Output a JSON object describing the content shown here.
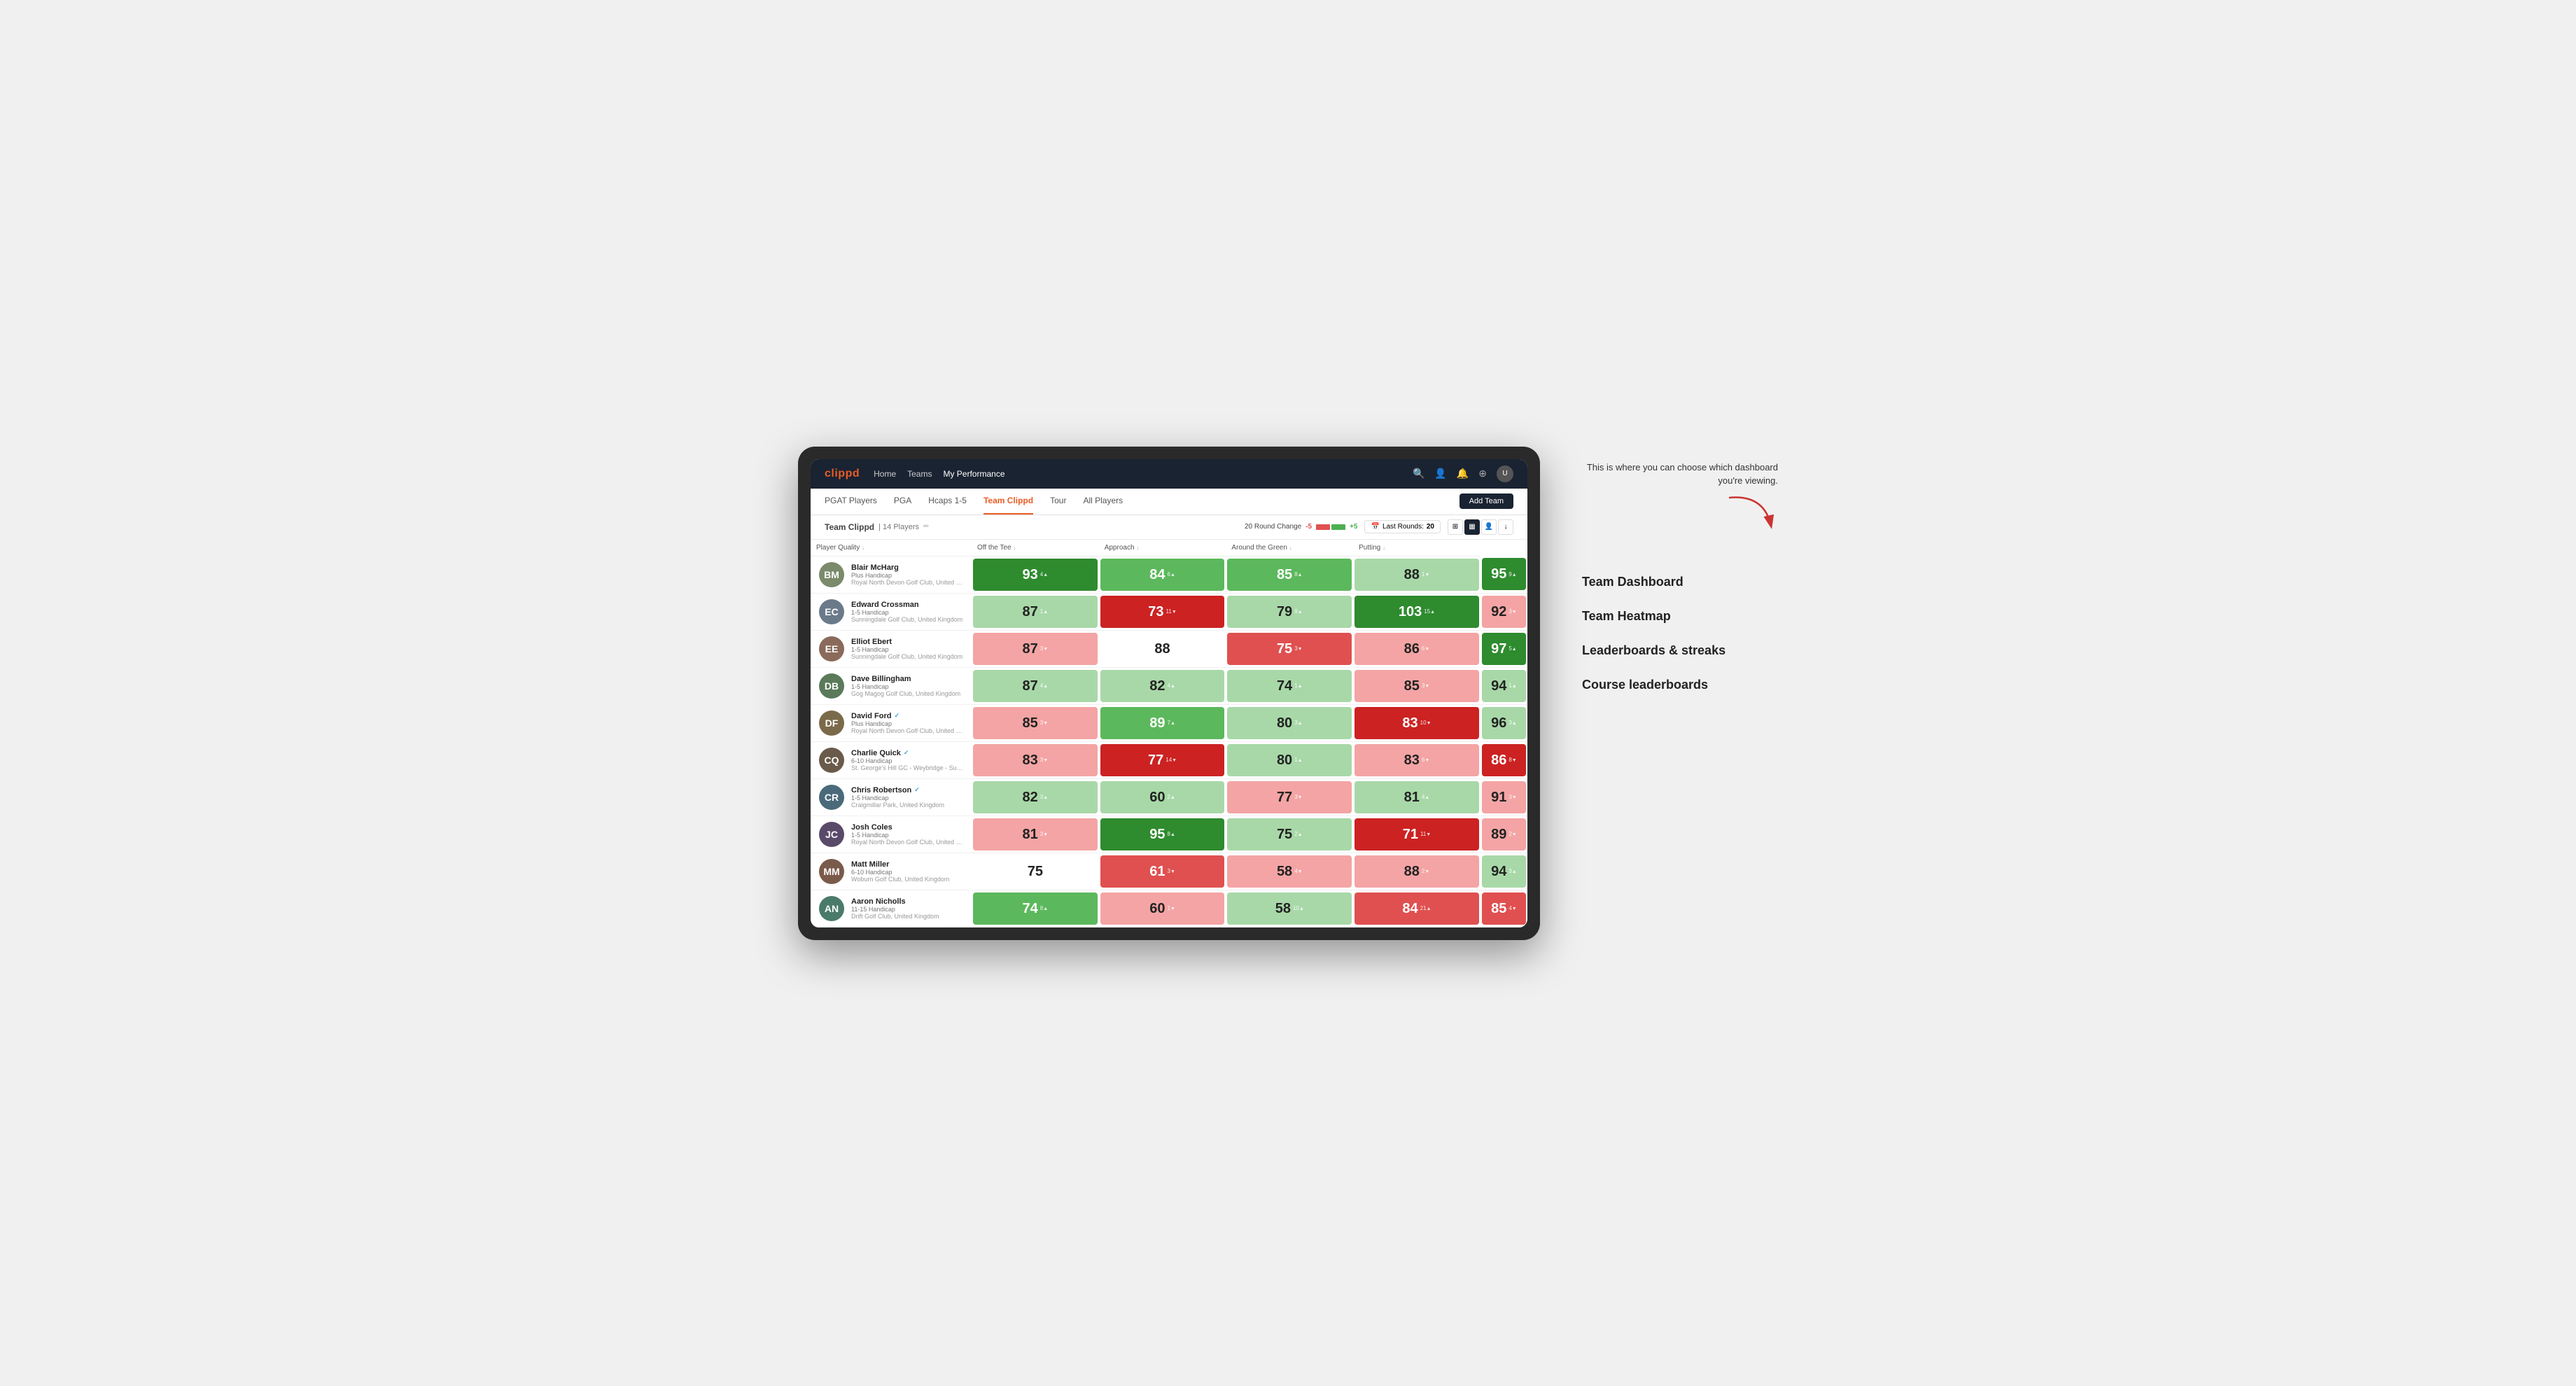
{
  "nav": {
    "logo": "clippd",
    "links": [
      "Home",
      "Teams",
      "My Performance"
    ],
    "active_link": "My Performance",
    "icons": [
      "🔍",
      "👤",
      "🔔",
      "⊕",
      "👤"
    ]
  },
  "sub_nav": {
    "links": [
      "PGAT Players",
      "PGA",
      "Hcaps 1-5",
      "Team Clippd",
      "Tour",
      "All Players"
    ],
    "active_link": "Team Clippd",
    "add_team_label": "Add Team"
  },
  "team_header": {
    "team_name": "Team Clippd",
    "separator": "|",
    "player_count": "14 Players",
    "round_change_label": "20 Round Change",
    "neg_label": "-5",
    "pos_label": "+5",
    "last_rounds_label": "Last Rounds:",
    "last_rounds_value": "20"
  },
  "table": {
    "columns": [
      {
        "key": "player",
        "label": "Player Quality",
        "arrow": "↓"
      },
      {
        "key": "off_tee",
        "label": "Off the Tee",
        "arrow": "↓"
      },
      {
        "key": "approach",
        "label": "Approach",
        "arrow": "↓"
      },
      {
        "key": "around_green",
        "label": "Around the Green",
        "arrow": "↓"
      },
      {
        "key": "putting",
        "label": "Putting",
        "arrow": "↓"
      }
    ],
    "rows": [
      {
        "name": "Blair McHarg",
        "handicap": "Plus Handicap",
        "club": "Royal North Devon Golf Club, United Kingdom",
        "initials": "BM",
        "avatar_color": "#7a8a6a",
        "scores": [
          {
            "value": "93",
            "delta": "4",
            "dir": "up",
            "bg": "bg-green-strong"
          },
          {
            "value": "84",
            "delta": "6",
            "dir": "up",
            "bg": "bg-green-mid"
          },
          {
            "value": "85",
            "delta": "8",
            "dir": "up",
            "bg": "bg-green-mid"
          },
          {
            "value": "88",
            "delta": "1",
            "dir": "down",
            "bg": "bg-green-light"
          },
          {
            "value": "95",
            "delta": "9",
            "dir": "up",
            "bg": "bg-green-strong"
          }
        ]
      },
      {
        "name": "Edward Crossman",
        "handicap": "1-5 Handicap",
        "club": "Sunningdale Golf Club, United Kingdom",
        "initials": "EC",
        "avatar_color": "#6a7a8a",
        "scores": [
          {
            "value": "87",
            "delta": "1",
            "dir": "up",
            "bg": "bg-green-light"
          },
          {
            "value": "73",
            "delta": "11",
            "dir": "down",
            "bg": "bg-red-strong"
          },
          {
            "value": "79",
            "delta": "9",
            "dir": "up",
            "bg": "bg-green-light"
          },
          {
            "value": "103",
            "delta": "15",
            "dir": "up",
            "bg": "bg-green-strong"
          },
          {
            "value": "92",
            "delta": "3",
            "dir": "down",
            "bg": "bg-red-light"
          }
        ]
      },
      {
        "name": "Elliot Ebert",
        "handicap": "1-5 Handicap",
        "club": "Sunningdale Golf Club, United Kingdom",
        "initials": "EE",
        "avatar_color": "#8a6a5a",
        "scores": [
          {
            "value": "87",
            "delta": "3",
            "dir": "down",
            "bg": "bg-red-light"
          },
          {
            "value": "88",
            "delta": "",
            "dir": "",
            "bg": "bg-white"
          },
          {
            "value": "75",
            "delta": "3",
            "dir": "down",
            "bg": "bg-red-mid"
          },
          {
            "value": "86",
            "delta": "6",
            "dir": "down",
            "bg": "bg-red-light"
          },
          {
            "value": "97",
            "delta": "5",
            "dir": "up",
            "bg": "bg-green-strong"
          }
        ]
      },
      {
        "name": "Dave Billingham",
        "handicap": "1-5 Handicap",
        "club": "Gog Magog Golf Club, United Kingdom",
        "initials": "DB",
        "avatar_color": "#5a7a5a",
        "scores": [
          {
            "value": "87",
            "delta": "4",
            "dir": "up",
            "bg": "bg-green-light"
          },
          {
            "value": "82",
            "delta": "4",
            "dir": "up",
            "bg": "bg-green-light"
          },
          {
            "value": "74",
            "delta": "1",
            "dir": "up",
            "bg": "bg-green-light"
          },
          {
            "value": "85",
            "delta": "3",
            "dir": "down",
            "bg": "bg-red-light"
          },
          {
            "value": "94",
            "delta": "1",
            "dir": "up",
            "bg": "bg-green-light"
          }
        ]
      },
      {
        "name": "David Ford",
        "handicap": "Plus Handicap",
        "club": "Royal North Devon Golf Club, United Kingdom",
        "initials": "DF",
        "avatar_color": "#7a6a4a",
        "verified": true,
        "scores": [
          {
            "value": "85",
            "delta": "3",
            "dir": "down",
            "bg": "bg-red-light"
          },
          {
            "value": "89",
            "delta": "7",
            "dir": "up",
            "bg": "bg-green-mid"
          },
          {
            "value": "80",
            "delta": "3",
            "dir": "up",
            "bg": "bg-green-light"
          },
          {
            "value": "83",
            "delta": "10",
            "dir": "down",
            "bg": "bg-red-strong"
          },
          {
            "value": "96",
            "delta": "3",
            "dir": "up",
            "bg": "bg-green-light"
          }
        ]
      },
      {
        "name": "Charlie Quick",
        "handicap": "6-10 Handicap",
        "club": "St. George's Hill GC - Weybridge - Surrey, Uni...",
        "initials": "CQ",
        "avatar_color": "#6a5a4a",
        "verified": true,
        "scores": [
          {
            "value": "83",
            "delta": "3",
            "dir": "down",
            "bg": "bg-red-light"
          },
          {
            "value": "77",
            "delta": "14",
            "dir": "down",
            "bg": "bg-red-strong"
          },
          {
            "value": "80",
            "delta": "1",
            "dir": "up",
            "bg": "bg-green-light"
          },
          {
            "value": "83",
            "delta": "6",
            "dir": "down",
            "bg": "bg-red-light"
          },
          {
            "value": "86",
            "delta": "8",
            "dir": "down",
            "bg": "bg-red-strong"
          }
        ]
      },
      {
        "name": "Chris Robertson",
        "handicap": "1-5 Handicap",
        "club": "Craigmillar Park, United Kingdom",
        "initials": "CR",
        "avatar_color": "#4a6a7a",
        "verified": true,
        "scores": [
          {
            "value": "82",
            "delta": "3",
            "dir": "up",
            "bg": "bg-green-light"
          },
          {
            "value": "60",
            "delta": "2",
            "dir": "up",
            "bg": "bg-green-light"
          },
          {
            "value": "77",
            "delta": "3",
            "dir": "down",
            "bg": "bg-red-light"
          },
          {
            "value": "81",
            "delta": "4",
            "dir": "up",
            "bg": "bg-green-light"
          },
          {
            "value": "91",
            "delta": "3",
            "dir": "down",
            "bg": "bg-red-light"
          }
        ]
      },
      {
        "name": "Josh Coles",
        "handicap": "1-5 Handicap",
        "club": "Royal North Devon Golf Club, United Kingdom",
        "initials": "JC",
        "avatar_color": "#5a4a6a",
        "scores": [
          {
            "value": "81",
            "delta": "3",
            "dir": "down",
            "bg": "bg-red-light"
          },
          {
            "value": "95",
            "delta": "8",
            "dir": "up",
            "bg": "bg-green-strong"
          },
          {
            "value": "75",
            "delta": "2",
            "dir": "up",
            "bg": "bg-green-light"
          },
          {
            "value": "71",
            "delta": "11",
            "dir": "down",
            "bg": "bg-red-strong"
          },
          {
            "value": "89",
            "delta": "2",
            "dir": "down",
            "bg": "bg-red-light"
          }
        ]
      },
      {
        "name": "Matt Miller",
        "handicap": "6-10 Handicap",
        "club": "Woburn Golf Club, United Kingdom",
        "initials": "MM",
        "avatar_color": "#7a5a4a",
        "scores": [
          {
            "value": "75",
            "delta": "",
            "dir": "",
            "bg": "bg-white"
          },
          {
            "value": "61",
            "delta": "3",
            "dir": "down",
            "bg": "bg-red-mid"
          },
          {
            "value": "58",
            "delta": "4",
            "dir": "down",
            "bg": "bg-red-light"
          },
          {
            "value": "88",
            "delta": "2",
            "dir": "down",
            "bg": "bg-red-light"
          },
          {
            "value": "94",
            "delta": "3",
            "dir": "up",
            "bg": "bg-green-light"
          }
        ]
      },
      {
        "name": "Aaron Nicholls",
        "handicap": "11-15 Handicap",
        "club": "Drift Golf Club, United Kingdom",
        "initials": "AN",
        "avatar_color": "#4a7a6a",
        "scores": [
          {
            "value": "74",
            "delta": "8",
            "dir": "up",
            "bg": "bg-green-mid"
          },
          {
            "value": "60",
            "delta": "1",
            "dir": "down",
            "bg": "bg-red-light"
          },
          {
            "value": "58",
            "delta": "10",
            "dir": "up",
            "bg": "bg-green-light"
          },
          {
            "value": "84",
            "delta": "21",
            "dir": "up",
            "bg": "bg-red-mid"
          },
          {
            "value": "85",
            "delta": "4",
            "dir": "down",
            "bg": "bg-red-mid"
          }
        ]
      }
    ]
  },
  "annotation": {
    "intro_text": "This is where you can choose which dashboard you're viewing.",
    "items": [
      "Team Dashboard",
      "Team Heatmap",
      "Leaderboards & streaks",
      "Course leaderboards"
    ]
  }
}
